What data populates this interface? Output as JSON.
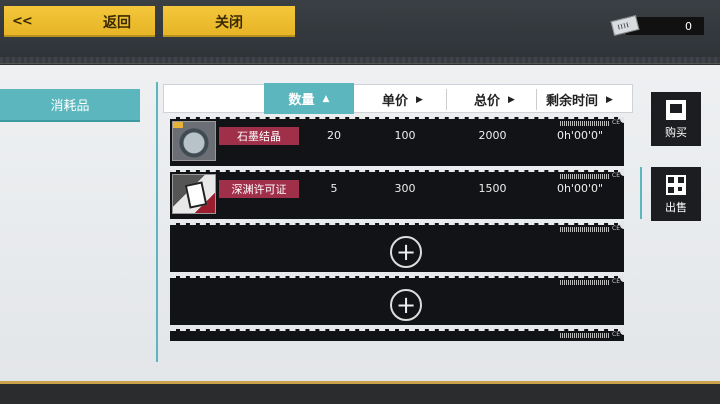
{
  "topbar": {
    "back_chevron": "<<",
    "back_label": "返回",
    "close_label": "关闭",
    "currency_amount": "0"
  },
  "sidebar": {
    "category": "消耗品"
  },
  "header": {
    "qty": "数量",
    "unit_price": "单价",
    "total_price": "总价",
    "remaining_time": "剩余时间",
    "qty_arrow": "▲",
    "unit_arrow": "▶",
    "total_arrow": "▶",
    "time_arrow": "▶"
  },
  "listings": [
    {
      "name": "石墨结晶",
      "qty": "20",
      "unit_price": "100",
      "total_price": "2000",
      "time": "0h'00'0\""
    },
    {
      "name": "深渊许可证",
      "qty": "5",
      "unit_price": "300",
      "total_price": "1500",
      "time": "0h'00'0\""
    }
  ],
  "empty_slot": {
    "plus": "+"
  },
  "side": {
    "buy_label": "购买",
    "sell_label": "出售"
  },
  "tags": {
    "ce": "CE"
  }
}
